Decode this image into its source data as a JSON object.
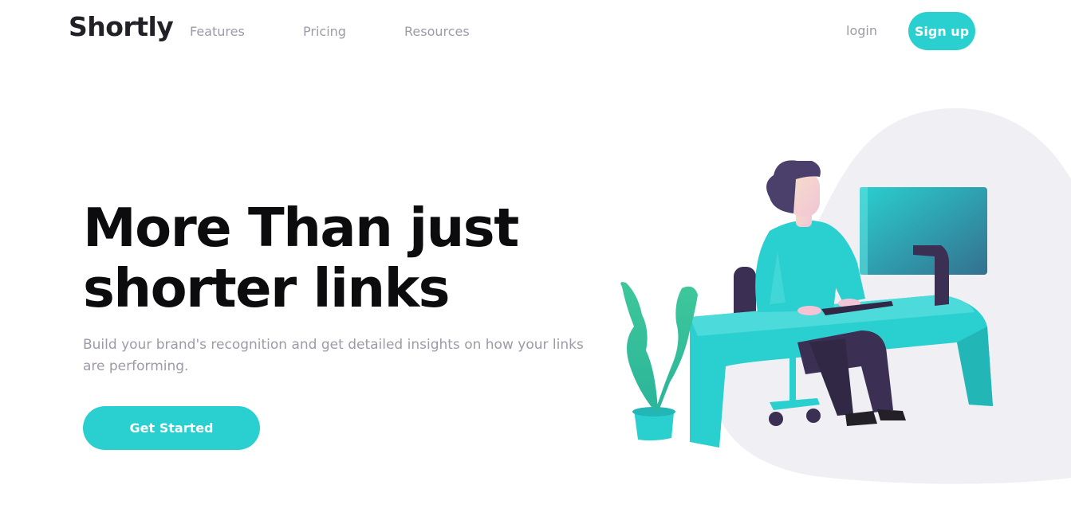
{
  "header": {
    "logo": "Shortly",
    "nav": {
      "features": "Features",
      "pricing": "Pricing",
      "resources": "Resources"
    },
    "login": "login",
    "signup": "Sign up"
  },
  "hero": {
    "title": "More Than just shorter links",
    "subtitle": "Build your brand's recognition and get detailed insights on how your links are performing.",
    "cta": "Get Started",
    "illustration": "person-working-at-desk-illustration"
  },
  "colors": {
    "accent": "#2acfcf",
    "heading": "#0c0c0e",
    "muted": "#9e9aa7",
    "blob": "#efeff4"
  }
}
